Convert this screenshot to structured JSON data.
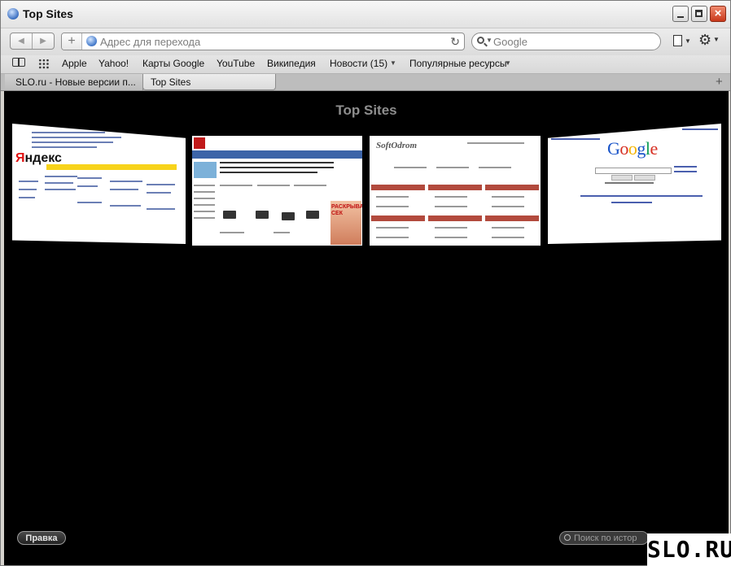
{
  "window": {
    "title": "Top Sites"
  },
  "toolbar": {
    "back_glyph": "◀",
    "forward_glyph": "▶",
    "add_glyph": "+",
    "address_placeholder": "Адрес для перехода",
    "reload_glyph": "↻",
    "search_placeholder": "Google",
    "page_icon": "page-icon",
    "settings_icon": "gear-icon"
  },
  "bookmarks": {
    "items": [
      {
        "label": "Apple"
      },
      {
        "label": "Yahoo!"
      },
      {
        "label": "Карты Google"
      },
      {
        "label": "YouTube"
      },
      {
        "label": "Википедия"
      },
      {
        "label": "Новости (15)"
      },
      {
        "label": "Популярные ресурсы"
      }
    ]
  },
  "tabs": [
    {
      "label": "SLO.ru - Новые версии п...",
      "active": false
    },
    {
      "label": "Top Sites",
      "active": true
    }
  ],
  "top_sites": {
    "heading": "Top Sites",
    "thumbnails": [
      {
        "site": "Яндекс"
      },
      {
        "site": "SLO.ru"
      },
      {
        "site": "Softodrom"
      },
      {
        "site": "Google"
      }
    ],
    "promo_text": "РАСКРЫВАЕ СЕК",
    "softodrom_text": "SoftOdrom"
  },
  "footer": {
    "edit_label": "Правка",
    "history_search_placeholder": "Поиск по истор"
  },
  "watermark": "SLO.RU",
  "colors": {
    "content_bg": "#000000",
    "heading": "#8e8e8e",
    "yandex_yellow": "#f7d31b"
  }
}
